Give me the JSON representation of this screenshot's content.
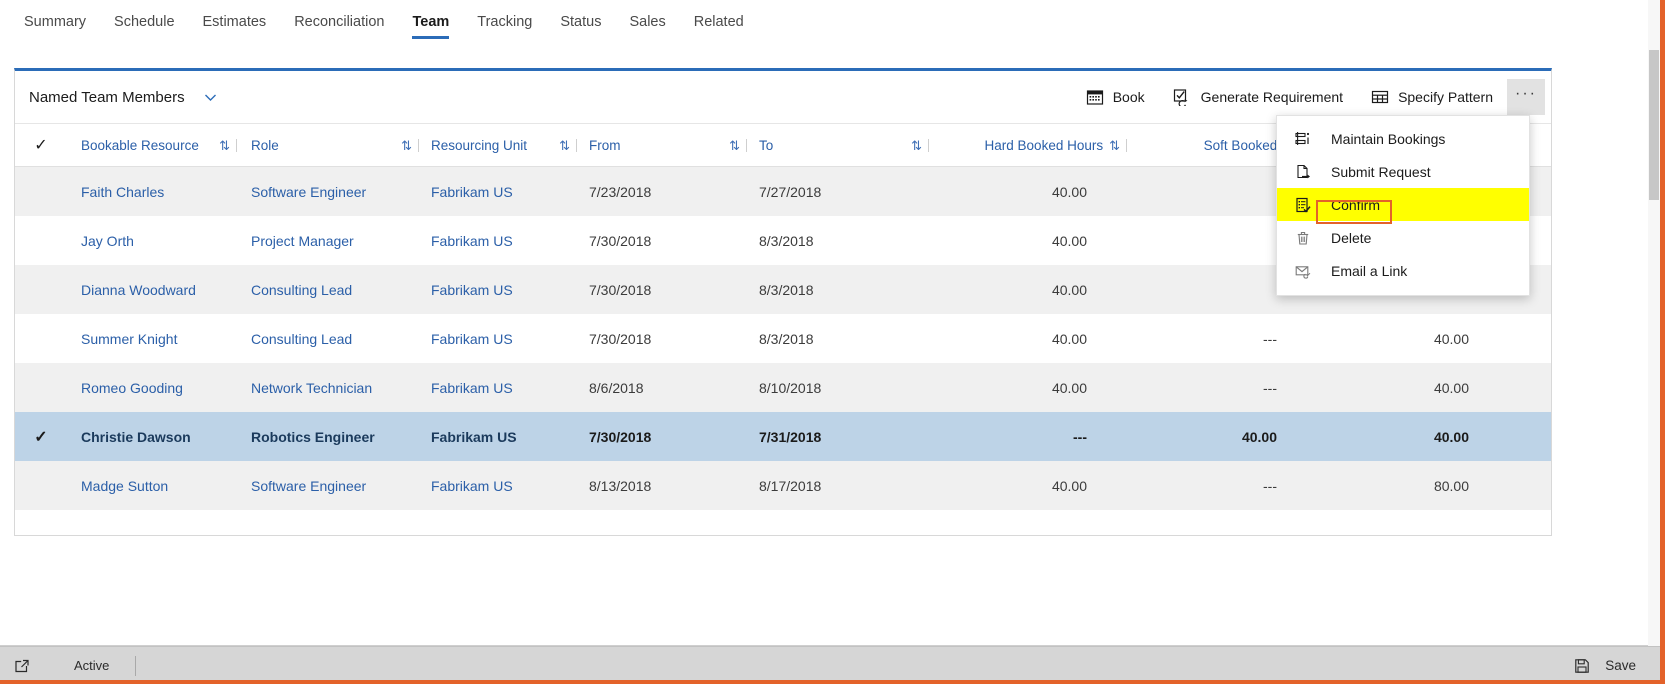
{
  "tabs": [
    {
      "label": "Summary",
      "active": false
    },
    {
      "label": "Schedule",
      "active": false
    },
    {
      "label": "Estimates",
      "active": false
    },
    {
      "label": "Reconciliation",
      "active": false
    },
    {
      "label": "Team",
      "active": true
    },
    {
      "label": "Tracking",
      "active": false
    },
    {
      "label": "Status",
      "active": false
    },
    {
      "label": "Sales",
      "active": false
    },
    {
      "label": "Related",
      "active": false
    }
  ],
  "panel": {
    "title": "Named Team Members",
    "commands": [
      {
        "label": "Book",
        "icon": "calendar-icon"
      },
      {
        "label": "Generate Requirement",
        "icon": "checkbox-refresh-icon"
      },
      {
        "label": "Specify Pattern",
        "icon": "grid-table-icon"
      }
    ],
    "overflow_label": "···"
  },
  "grid": {
    "columns": [
      {
        "key": "check",
        "label": "✓"
      },
      {
        "key": "resource",
        "label": "Bookable Resource"
      },
      {
        "key": "role",
        "label": "Role"
      },
      {
        "key": "unit",
        "label": "Resourcing Unit"
      },
      {
        "key": "from",
        "label": "From"
      },
      {
        "key": "to",
        "label": "To"
      },
      {
        "key": "hard",
        "label": "Hard Booked Hours"
      },
      {
        "key": "soft",
        "label": "Soft Booked Hours"
      },
      {
        "key": "total",
        "label": ""
      }
    ],
    "sort_icon": "⇅",
    "rows": [
      {
        "selected": false,
        "resource": "Faith Charles",
        "role": "Software Engineer",
        "unit": "Fabrikam US",
        "from": "7/23/2018",
        "to": "7/27/2018",
        "hard": "40.00",
        "soft": "",
        "total": ""
      },
      {
        "selected": false,
        "resource": "Jay Orth",
        "role": "Project Manager",
        "unit": "Fabrikam US",
        "from": "7/30/2018",
        "to": "8/3/2018",
        "hard": "40.00",
        "soft": "",
        "total": ""
      },
      {
        "selected": false,
        "resource": "Dianna Woodward",
        "role": "Consulting Lead",
        "unit": "Fabrikam US",
        "from": "7/30/2018",
        "to": "8/3/2018",
        "hard": "40.00",
        "soft": "",
        "total": ""
      },
      {
        "selected": false,
        "resource": "Summer Knight",
        "role": "Consulting Lead",
        "unit": "Fabrikam US",
        "from": "7/30/2018",
        "to": "8/3/2018",
        "hard": "40.00",
        "soft": "---",
        "total": "40.00"
      },
      {
        "selected": false,
        "resource": "Romeo Gooding",
        "role": "Network Technician",
        "unit": "Fabrikam US",
        "from": "8/6/2018",
        "to": "8/10/2018",
        "hard": "40.00",
        "soft": "---",
        "total": "40.00"
      },
      {
        "selected": true,
        "resource": "Christie Dawson",
        "role": "Robotics Engineer",
        "unit": "Fabrikam US",
        "from": "7/30/2018",
        "to": "7/31/2018",
        "hard": "---",
        "soft": "40.00",
        "total": "40.00"
      },
      {
        "selected": false,
        "resource": "Madge Sutton",
        "role": "Software Engineer",
        "unit": "Fabrikam US",
        "from": "8/13/2018",
        "to": "8/17/2018",
        "hard": "40.00",
        "soft": "---",
        "total": "80.00"
      }
    ]
  },
  "menu": {
    "items": [
      {
        "label": "Maintain Bookings",
        "icon": "maintain-bookings-icon",
        "highlighted": false
      },
      {
        "label": "Submit Request",
        "icon": "submit-request-icon",
        "highlighted": false
      },
      {
        "label": "Confirm",
        "icon": "confirm-icon",
        "highlighted": true
      },
      {
        "label": "Delete",
        "icon": "trash-icon",
        "highlighted": false
      },
      {
        "label": "Email a Link",
        "icon": "email-link-icon",
        "highlighted": false
      }
    ]
  },
  "statusbar": {
    "status": "Active",
    "save_label": "Save"
  },
  "colors": {
    "accent": "#2b6cb8",
    "link": "#2b5fa8",
    "selected_row": "#bdd3e7",
    "alt_row": "#f0f0f0",
    "highlight": "#ffff00",
    "annotation": "#e3622a"
  }
}
